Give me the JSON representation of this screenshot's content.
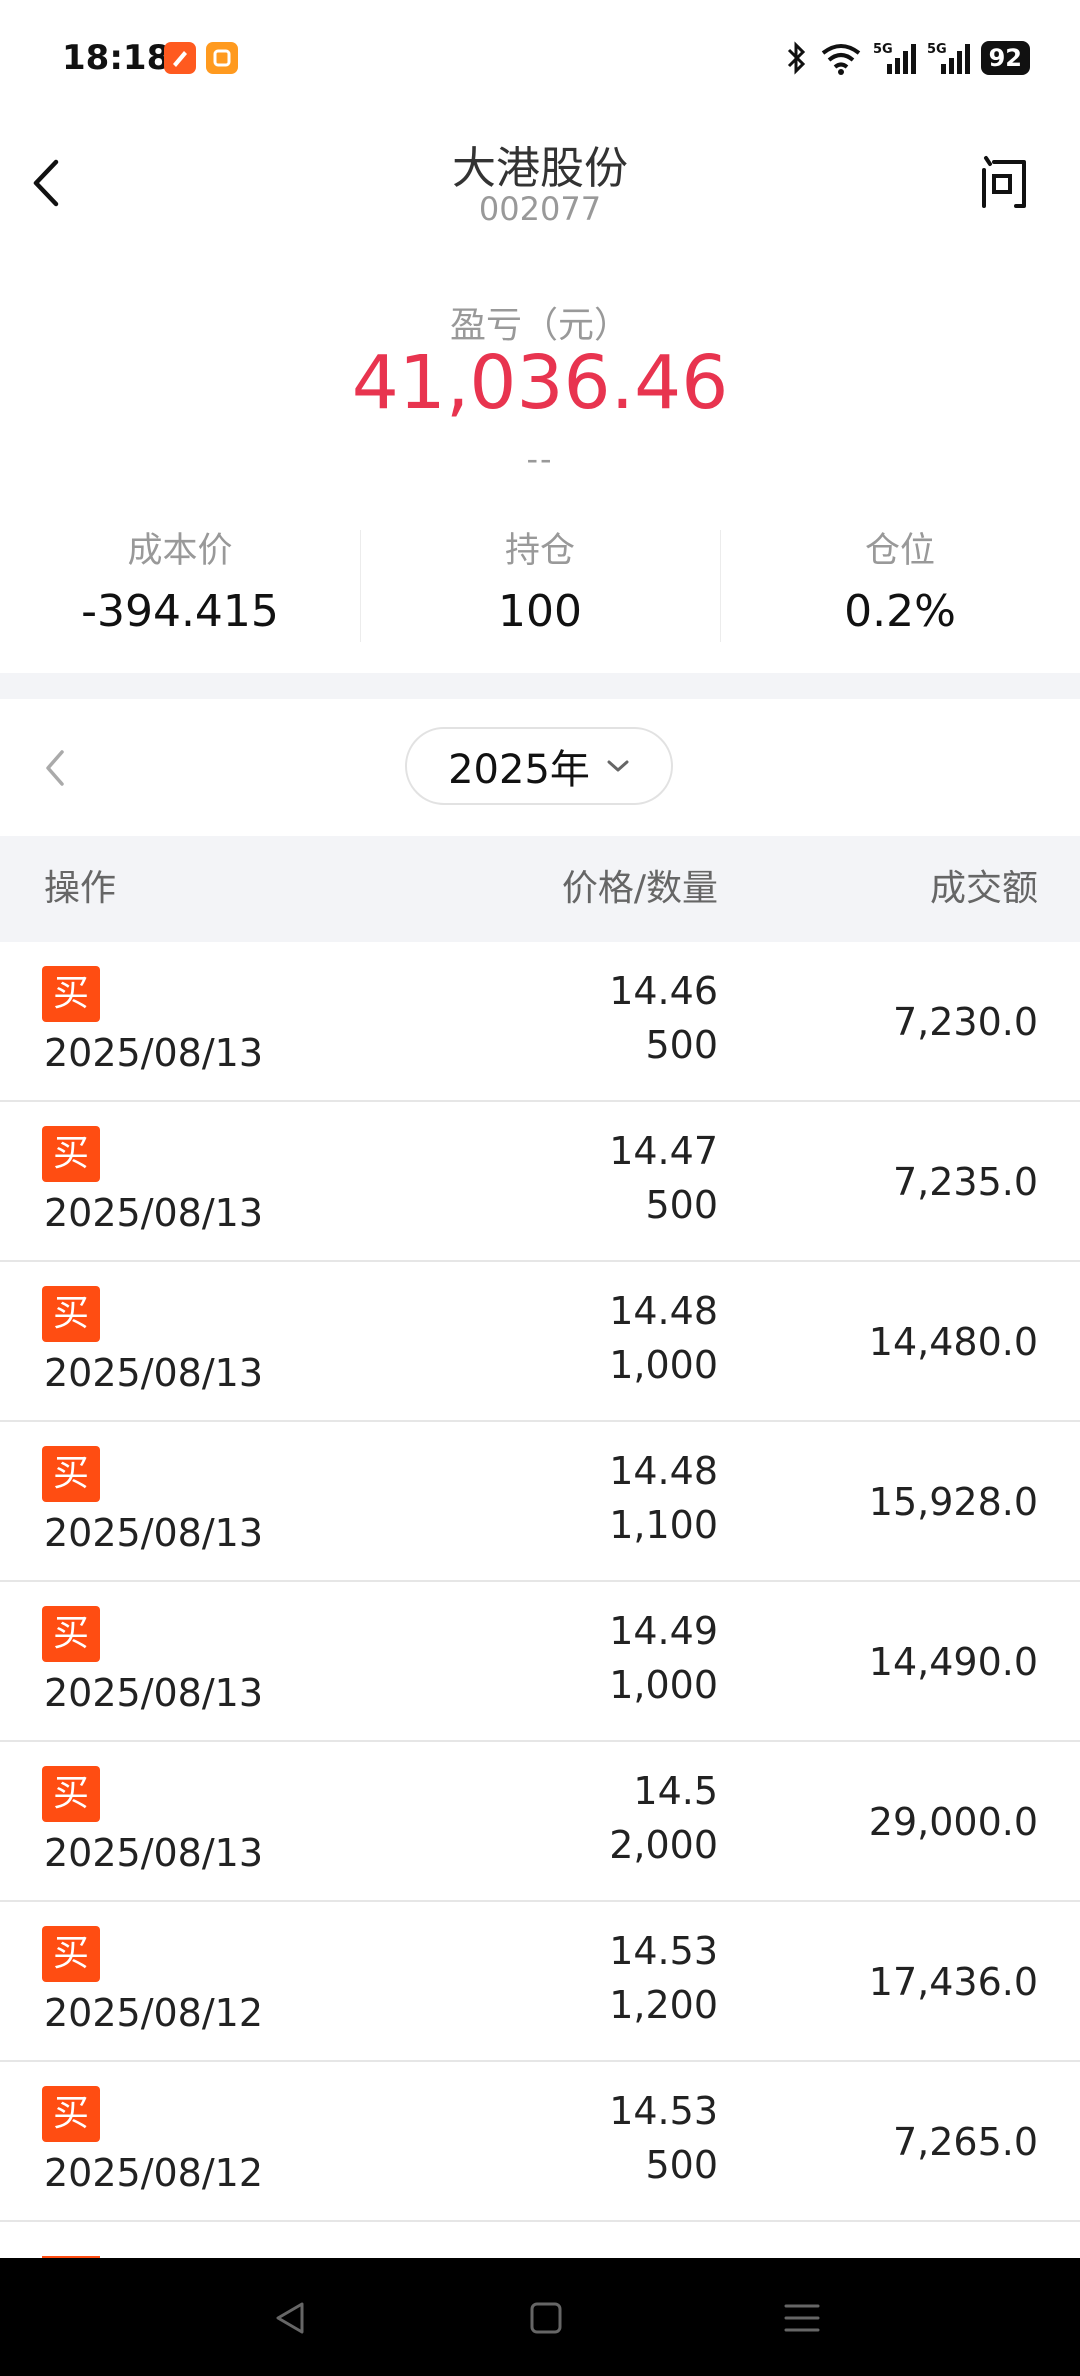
{
  "status": {
    "time": "18:18",
    "battery": "92",
    "signal_label": "5G"
  },
  "header": {
    "title": "大港股份",
    "code": "002077",
    "ask_label": "问"
  },
  "pnl": {
    "label": "盈亏（元）",
    "value": "41,036.46",
    "sub": "--"
  },
  "stats": [
    {
      "label": "成本价",
      "value": "-394.415"
    },
    {
      "label": "持仓",
      "value": "100"
    },
    {
      "label": "仓位",
      "value": "0.2%"
    }
  ],
  "year_selector": {
    "value": "2025年"
  },
  "table": {
    "headers": {
      "op": "操作",
      "price_qty": "价格/数量",
      "amount": "成交额"
    },
    "rows": [
      {
        "type": "买",
        "date": "2025/08/13",
        "price": "14.46",
        "qty": "500",
        "amount": "7,230.0"
      },
      {
        "type": "买",
        "date": "2025/08/13",
        "price": "14.47",
        "qty": "500",
        "amount": "7,235.0"
      },
      {
        "type": "买",
        "date": "2025/08/13",
        "price": "14.48",
        "qty": "1,000",
        "amount": "14,480.0"
      },
      {
        "type": "买",
        "date": "2025/08/13",
        "price": "14.48",
        "qty": "1,100",
        "amount": "15,928.0"
      },
      {
        "type": "买",
        "date": "2025/08/13",
        "price": "14.49",
        "qty": "1,000",
        "amount": "14,490.0"
      },
      {
        "type": "买",
        "date": "2025/08/13",
        "price": "14.5",
        "qty": "2,000",
        "amount": "29,000.0"
      },
      {
        "type": "买",
        "date": "2025/08/12",
        "price": "14.53",
        "qty": "1,200",
        "amount": "17,436.0"
      },
      {
        "type": "买",
        "date": "2025/08/12",
        "price": "14.53",
        "qty": "500",
        "amount": "7,265.0"
      }
    ]
  },
  "colors": {
    "profit": "#e8344f",
    "buy_tag": "#ff4d12",
    "header_bg": "#f3f4f7"
  }
}
